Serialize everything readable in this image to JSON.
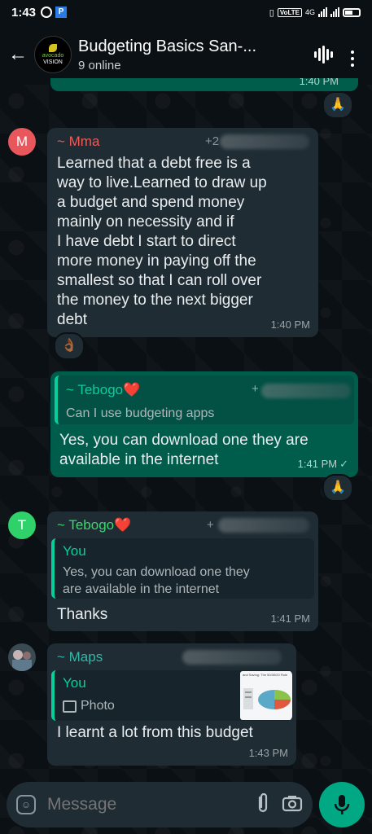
{
  "status_bar": {
    "time": "1:43",
    "network": "4G",
    "volte": "VoLTE"
  },
  "header": {
    "title": "Budgeting Basics San-...",
    "subtitle": "9 online",
    "avatar_text_1": "avocado",
    "avatar_text_2": "VISION"
  },
  "messages": [
    {
      "sender": "~ Mma",
      "sender_color": "#f05a5a",
      "avatar_letter": "M",
      "avatar_color": "#e8575b",
      "phone": "+2",
      "text": "Learned that a debt free is a\nway to live.Learned to draw up\na budget and spend money\nmainly on necessity and if\nI have debt I start to direct\nmore money in paying off the\nsmallest so that I can roll over\nthe money to the next bigger\ndebt",
      "time": "1:40 PM",
      "reaction": "👌🏾"
    },
    {
      "quote_name": "~ Tebogo❤️",
      "quote_phone": "+",
      "quote_text": "Can I use budgeting apps",
      "text": "Yes, you can download one they are\navailable in the internet",
      "time": "1:41 PM",
      "tick": "✓",
      "reaction": "🙏"
    },
    {
      "sender": "~ Tebogo❤️",
      "sender_color": "#3ed56f",
      "avatar_letter": "T",
      "avatar_color": "#2fd16b",
      "phone": "+",
      "quote_name": "You",
      "quote_text": "Yes, you can download one they\nare available in the internet",
      "text": "Thanks",
      "time": "1:41 PM"
    },
    {
      "sender": "~ Maps",
      "sender_color": "#34b7a7",
      "quote_name": "You",
      "quote_media": "Photo",
      "thumb_title": "and Saving: The 50/30/20 Rule",
      "text": "I learnt a lot from this budget",
      "time": "1:43 PM"
    }
  ],
  "top_partial": {
    "time": "1:40 PM",
    "reaction": "🙏"
  },
  "composer": {
    "placeholder": "Message"
  },
  "colors": {
    "incoming_bubble": "#1f2c34",
    "outgoing_bubble": "#005c4b",
    "accent": "#00a884"
  }
}
